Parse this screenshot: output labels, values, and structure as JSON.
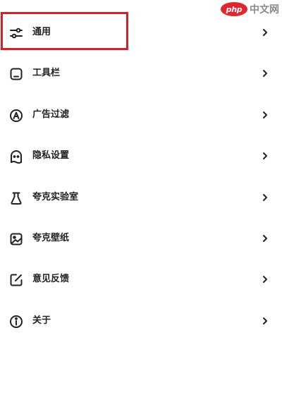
{
  "watermark": {
    "logo": "php",
    "text": "中文网"
  },
  "colors": {
    "highlight": "#d2232a",
    "text": "#222222"
  },
  "menu": {
    "items": [
      {
        "key": "general",
        "label": "通用",
        "icon": "sliders-icon",
        "highlighted": true
      },
      {
        "key": "toolbar",
        "label": "工具栏",
        "icon": "toolbar-icon"
      },
      {
        "key": "adblock",
        "label": "广告过滤",
        "icon": "adblock-icon"
      },
      {
        "key": "privacy",
        "label": "隐私设置",
        "icon": "ghost-icon"
      },
      {
        "key": "lab",
        "label": "夸克实验室",
        "icon": "flask-icon"
      },
      {
        "key": "wallpaper",
        "label": "夸克壁纸",
        "icon": "image-icon"
      },
      {
        "key": "feedback",
        "label": "意见反馈",
        "icon": "edit-icon"
      },
      {
        "key": "about",
        "label": "关于",
        "icon": "info-icon"
      }
    ]
  }
}
